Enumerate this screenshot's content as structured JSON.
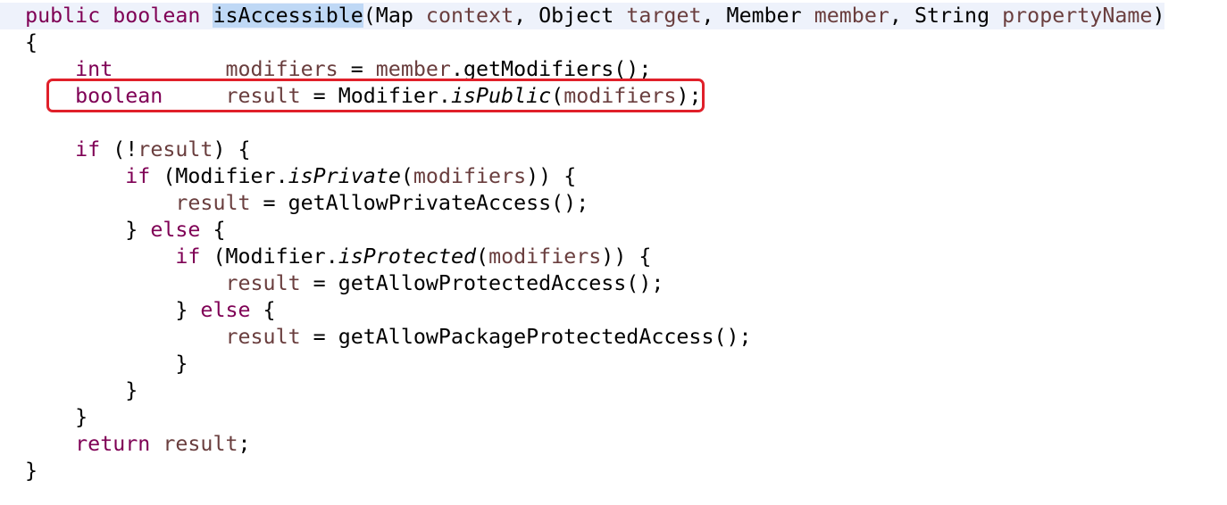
{
  "editor": {
    "lines": [
      [
        {
          "t": "  ",
          "c": ""
        },
        {
          "t": "public",
          "c": "kw"
        },
        {
          "t": " ",
          "c": ""
        },
        {
          "t": "boolean",
          "c": "kw"
        },
        {
          "t": " ",
          "c": ""
        },
        {
          "t": "isAccessible",
          "c": "sel"
        },
        {
          "t": "(Map ",
          "c": ""
        },
        {
          "t": "context",
          "c": "var"
        },
        {
          "t": ", Object ",
          "c": ""
        },
        {
          "t": "target",
          "c": "var"
        },
        {
          "t": ", Member ",
          "c": ""
        },
        {
          "t": "member",
          "c": "var"
        },
        {
          "t": ", String ",
          "c": ""
        },
        {
          "t": "propertyName",
          "c": "var"
        },
        {
          "t": ")",
          "c": ""
        }
      ],
      [
        {
          "t": "  {",
          "c": ""
        }
      ],
      [
        {
          "t": "      ",
          "c": ""
        },
        {
          "t": "int",
          "c": "kw"
        },
        {
          "t": "         ",
          "c": ""
        },
        {
          "t": "modifiers",
          "c": "var"
        },
        {
          "t": " = ",
          "c": ""
        },
        {
          "t": "member",
          "c": "var"
        },
        {
          "t": ".getModifiers();",
          "c": ""
        }
      ],
      [
        {
          "t": "      ",
          "c": ""
        },
        {
          "t": "boolean",
          "c": "kw"
        },
        {
          "t": "     ",
          "c": ""
        },
        {
          "t": "result",
          "c": "var"
        },
        {
          "t": " = Modifier.",
          "c": ""
        },
        {
          "t": "isPublic",
          "c": "it"
        },
        {
          "t": "(",
          "c": ""
        },
        {
          "t": "modifiers",
          "c": "var"
        },
        {
          "t": ");",
          "c": ""
        }
      ],
      [
        {
          "t": "",
          "c": ""
        }
      ],
      [
        {
          "t": "      ",
          "c": ""
        },
        {
          "t": "if",
          "c": "kw"
        },
        {
          "t": " (!",
          "c": ""
        },
        {
          "t": "result",
          "c": "var"
        },
        {
          "t": ") {",
          "c": ""
        }
      ],
      [
        {
          "t": "          ",
          "c": ""
        },
        {
          "t": "if",
          "c": "kw"
        },
        {
          "t": " (Modifier.",
          "c": ""
        },
        {
          "t": "isPrivate",
          "c": "it"
        },
        {
          "t": "(",
          "c": ""
        },
        {
          "t": "modifiers",
          "c": "var"
        },
        {
          "t": ")) {",
          "c": ""
        }
      ],
      [
        {
          "t": "              ",
          "c": ""
        },
        {
          "t": "result",
          "c": "var"
        },
        {
          "t": " = getAllowPrivateAccess();",
          "c": ""
        }
      ],
      [
        {
          "t": "          } ",
          "c": ""
        },
        {
          "t": "else",
          "c": "kw"
        },
        {
          "t": " {",
          "c": ""
        }
      ],
      [
        {
          "t": "              ",
          "c": ""
        },
        {
          "t": "if",
          "c": "kw"
        },
        {
          "t": " (Modifier.",
          "c": ""
        },
        {
          "t": "isProtected",
          "c": "it"
        },
        {
          "t": "(",
          "c": ""
        },
        {
          "t": "modifiers",
          "c": "var"
        },
        {
          "t": ")) {",
          "c": ""
        }
      ],
      [
        {
          "t": "                  ",
          "c": ""
        },
        {
          "t": "result",
          "c": "var"
        },
        {
          "t": " = getAllowProtectedAccess();",
          "c": ""
        }
      ],
      [
        {
          "t": "              } ",
          "c": ""
        },
        {
          "t": "else",
          "c": "kw"
        },
        {
          "t": " {",
          "c": ""
        }
      ],
      [
        {
          "t": "                  ",
          "c": ""
        },
        {
          "t": "result",
          "c": "var"
        },
        {
          "t": " = getAllowPackageProtectedAccess();",
          "c": ""
        }
      ],
      [
        {
          "t": "              }",
          "c": ""
        }
      ],
      [
        {
          "t": "          }",
          "c": ""
        }
      ],
      [
        {
          "t": "      }",
          "c": ""
        }
      ],
      [
        {
          "t": "      ",
          "c": ""
        },
        {
          "t": "return",
          "c": "kw"
        },
        {
          "t": " ",
          "c": ""
        },
        {
          "t": "result",
          "c": "var"
        },
        {
          "t": ";",
          "c": ""
        }
      ],
      [
        {
          "t": "  }",
          "c": ""
        }
      ]
    ]
  },
  "colors": {
    "keyword": "#7f0055",
    "variable": "#6a3e3e",
    "selection": "#bfd8f5",
    "annotation_box": "#e0202a"
  }
}
